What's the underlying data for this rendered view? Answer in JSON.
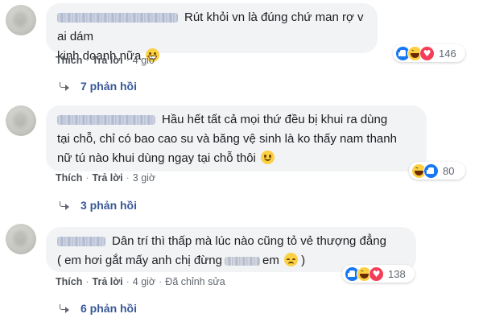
{
  "comments": [
    {
      "text_lines": [
        "Rút khỏi vn là đúng chứ man rợ v ai dám",
        "kinh doanh nữa"
      ],
      "emoji": "grinning-face-icon",
      "actions": {
        "like": "Thích",
        "reply": "Trả lời",
        "time": "4 giờ",
        "edited": ""
      },
      "reactions": [
        "like",
        "haha",
        "love"
      ],
      "reaction_count": "146",
      "replies_label": "7 phản hồi"
    },
    {
      "text_lines": [
        "Hầu hết tất cả mọi thứ đều bị khui ra dùng",
        "tại chỗ, chỉ có bao cao su và băng vệ sinh là ko thấy nam thanh",
        "nữ tú nào khui dùng ngay tại chỗ thôi"
      ],
      "emoji": "smiling-face-icon",
      "actions": {
        "like": "Thích",
        "reply": "Trả lời",
        "time": "3 giờ",
        "edited": ""
      },
      "reactions": [
        "haha",
        "like"
      ],
      "reaction_count": "80",
      "replies_label": "3 phản hồi"
    },
    {
      "text_lines": [
        "Dân trí thì thấp mà lúc nào cũng tỏ vẻ thượng đẳng",
        "( em hơi gắt mấy anh chị đừng",
        "em",
        ")"
      ],
      "emoji": "disappointed-face-icon",
      "actions": {
        "like": "Thích",
        "reply": "Trả lời",
        "time": "4 giờ",
        "edited": "Đã chỉnh sửa"
      },
      "reactions": [
        "like",
        "haha",
        "love"
      ],
      "reaction_count": "138",
      "replies_label": "6 phản hồi"
    }
  ],
  "colors": {
    "bubble": "#f2f3f5",
    "link": "#385898",
    "meta": "#606770",
    "like": "#1877f2",
    "love": "#f33e58",
    "haha": "#fbd043"
  }
}
